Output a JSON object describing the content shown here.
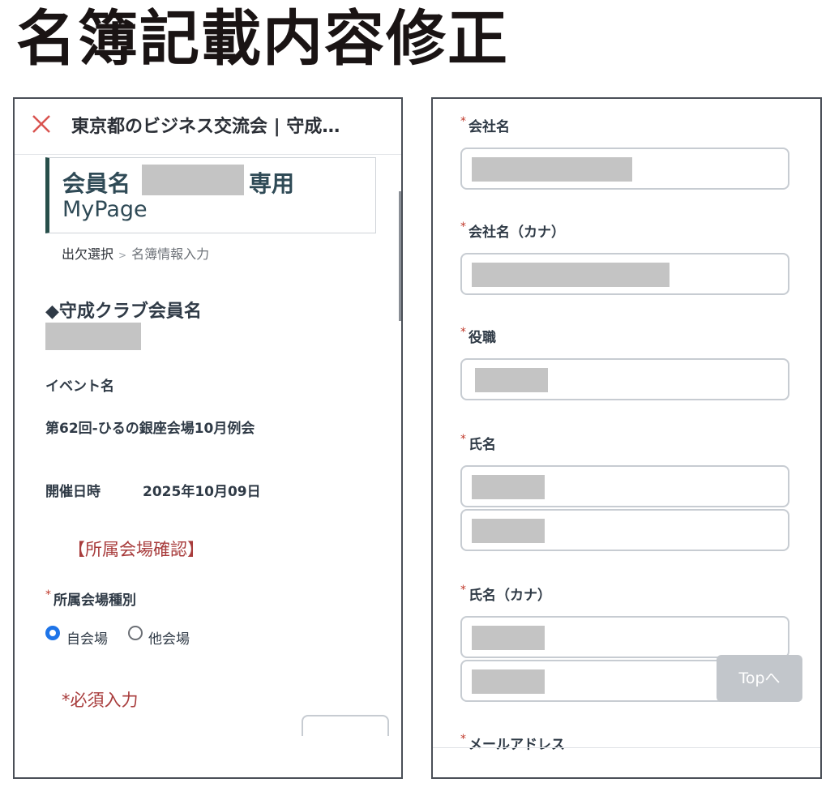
{
  "heading": "名簿記載内容修正",
  "left_panel": {
    "topbar": {
      "close_icon": "close-icon",
      "title": "東京都のビジネス交流会 | 守成…"
    },
    "mypage": {
      "prefix": "会員名",
      "suffix": "専用",
      "line2": "MyPage"
    },
    "breadcrumb": {
      "current": "出欠選択",
      "separator": ">",
      "next": "名簿情報入力"
    },
    "club_member_title": "◆守成クラブ会員名",
    "event_label": "イベント名",
    "event_value": "第62回-ひるの銀座会場10月例会",
    "date_label": "開催日時",
    "date_value": "2025年10月09日",
    "venue_confirm": "【所属会場確認】",
    "venue_type_label": "所属会場種別",
    "required_mark": "*",
    "radio_options": [
      {
        "label": "自会場",
        "selected": true
      },
      {
        "label": "他会場",
        "selected": false
      }
    ],
    "required_note": "*必須入力",
    "colors": {
      "accent_blue": "#1e74e8",
      "note_red": "#a83c3c",
      "bar_green": "#274e4a"
    }
  },
  "right_panel": {
    "required_mark": "*",
    "fields": {
      "company": "会社名",
      "company_kana": "会社名（カナ）",
      "position": "役職",
      "name": "氏名",
      "name_kana": "氏名（カナ）",
      "email": "メールアドレス"
    },
    "top_button": "Topへ"
  }
}
